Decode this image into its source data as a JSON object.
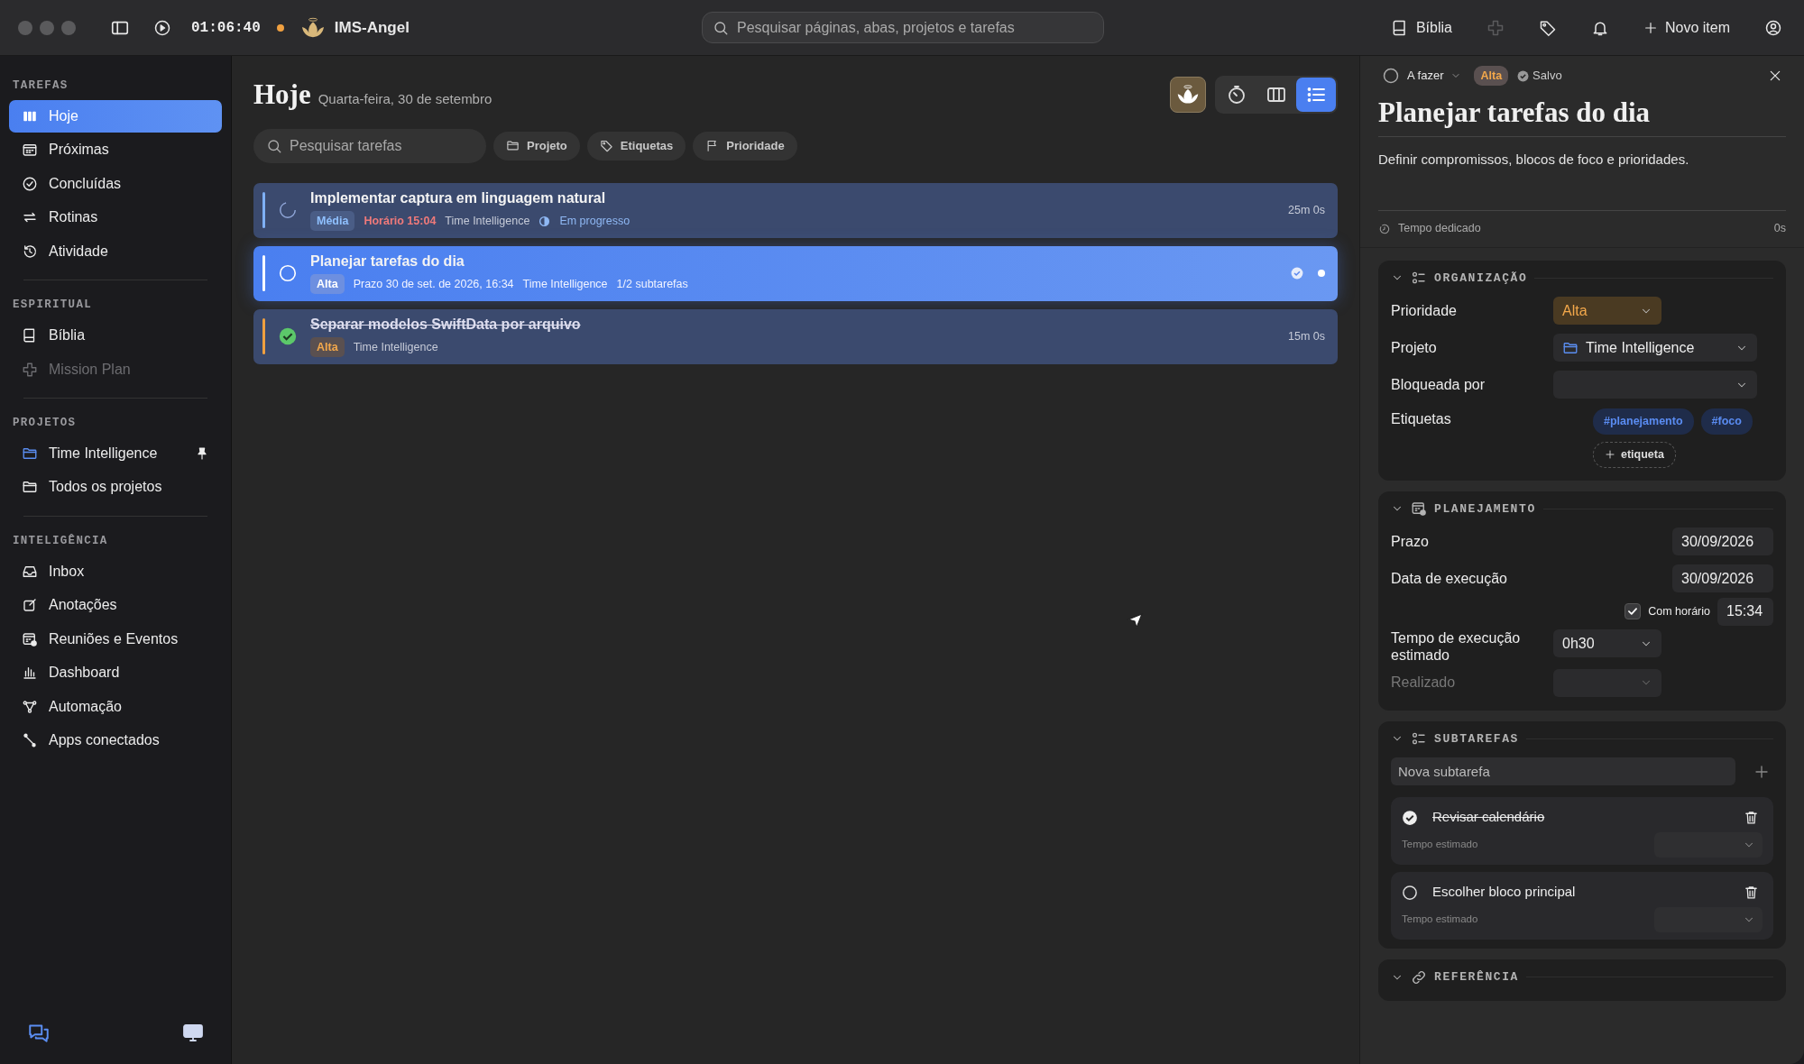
{
  "top_bar": {
    "timer": "01:06:40",
    "app_name": "IMS-Angel",
    "search_placeholder": "Pesquisar páginas, abas, projetos e tarefas",
    "actions": [
      {
        "kind": "book",
        "label": "Bíblia",
        "disabled": false
      },
      {
        "kind": "plus-cross",
        "disabled": true
      },
      {
        "kind": "tag",
        "disabled": false
      },
      {
        "kind": "bell",
        "disabled": false
      },
      {
        "kind": "plus",
        "label": "Novo item",
        "disabled": false
      },
      {
        "kind": "profile",
        "disabled": false
      }
    ]
  },
  "sidebar": {
    "sections": [
      {
        "title": "TAREFAS",
        "items": [
          {
            "label": "Hoje",
            "selected": true,
            "disabled": false,
            "pinned": false
          },
          {
            "label": "Próximas",
            "selected": false,
            "disabled": false,
            "pinned": false
          },
          {
            "label": "Concluídas",
            "selected": false,
            "disabled": false,
            "pinned": false
          },
          {
            "label": "Rotinas",
            "selected": false,
            "disabled": false,
            "pinned": false
          },
          {
            "label": "Atividade",
            "selected": false,
            "disabled": false,
            "pinned": false
          }
        ]
      },
      {
        "title": "ESPIRITUAL",
        "items": [
          {
            "label": "Bíblia",
            "selected": false,
            "disabled": false,
            "pinned": false
          },
          {
            "label": "Mission Plan",
            "selected": false,
            "disabled": true,
            "pinned": false
          }
        ]
      },
      {
        "title": "PROJETOS",
        "items": [
          {
            "label": "Time Intelligence",
            "selected": false,
            "disabled": false,
            "pinned": true
          },
          {
            "label": "Todos os projetos",
            "selected": false,
            "disabled": false,
            "pinned": false
          }
        ]
      },
      {
        "title": "INTELIGÊNCIA",
        "items": [
          {
            "label": "Inbox",
            "selected": false,
            "disabled": false,
            "pinned": false
          },
          {
            "label": "Anotações",
            "selected": false,
            "disabled": false,
            "pinned": false
          },
          {
            "label": "Reuniões e Eventos",
            "selected": false,
            "disabled": false,
            "pinned": false
          },
          {
            "label": "Dashboard",
            "selected": false,
            "disabled": false,
            "pinned": false
          },
          {
            "label": "Automação",
            "selected": false,
            "disabled": false,
            "pinned": false
          },
          {
            "label": "Apps conectados",
            "selected": false,
            "disabled": false,
            "pinned": false
          }
        ]
      }
    ]
  },
  "main": {
    "title": "Hoje",
    "date": "Quarta-feira, 30 de setembro",
    "views": [
      {
        "kind": "timer",
        "selected": false
      },
      {
        "kind": "columns",
        "selected": false
      },
      {
        "kind": "list",
        "selected": true
      }
    ],
    "search_placeholder": "Pesquisar tarefas",
    "filters": [
      {
        "label": "Projeto"
      },
      {
        "label": "Etiquetas"
      },
      {
        "label": "Prioridade"
      }
    ],
    "tasks": [
      {
        "title": "Implementar captura em linguagem natural",
        "kind": "in_progress",
        "selected": false,
        "priority": {
          "label": "Média",
          "kind": "media"
        },
        "meta": [
          {
            "text": "Horário 15:04",
            "kind": "alert"
          },
          {
            "text": "Time Intelligence",
            "kind": "plain"
          },
          {
            "text": "Em progresso",
            "kind": "progress"
          }
        ],
        "duration": "25m 0s"
      },
      {
        "title": "Planejar tarefas do dia",
        "kind": "todo",
        "selected": true,
        "priority": {
          "label": "Alta",
          "kind": "alta"
        },
        "meta": [
          {
            "text": "Prazo 30 de set. de 2026, 16:34",
            "kind": "plain"
          },
          {
            "text": "Time Intelligence",
            "kind": "plain"
          },
          {
            "text": "1/2 subtarefas",
            "kind": "plain"
          }
        ]
      },
      {
        "title": "Separar modelos SwiftData por arquivo",
        "kind": "done",
        "selected": false,
        "priority": {
          "label": "Alta",
          "kind": "alta"
        },
        "meta": [
          {
            "text": "Time Intelligence",
            "kind": "plain"
          }
        ],
        "duration": "15m 0s"
      }
    ]
  },
  "detail": {
    "status": "A fazer",
    "priority": {
      "label": "Alta",
      "kind": "alta"
    },
    "saved": "Salvo",
    "title": "Planejar tarefas do dia",
    "description": "Definir compromissos, blocos de foco e prioridades.",
    "time_label": "Tempo dedicado",
    "time_value": "0s",
    "sections": [
      {
        "title": "ORGANIZAÇÃO",
        "expanded": true,
        "rows": [
          {
            "kind": "priority",
            "label": "Prioridade",
            "value": "Alta",
            "disabled": false
          },
          {
            "kind": "project",
            "label": "Projeto",
            "value": "Time Intelligence",
            "disabled": false
          },
          {
            "kind": "select",
            "label": "Bloqueada por",
            "disabled": false
          },
          {
            "kind": "tags",
            "label": "Etiquetas",
            "tags": [
              "#planejamento",
              "#foco"
            ],
            "add_label": "etiqueta"
          }
        ]
      },
      {
        "title": "PLANEJAMENTO",
        "expanded": true,
        "rows": [
          {
            "kind": "date",
            "label": "Prazo",
            "value": "30/09/2026"
          },
          {
            "kind": "date",
            "label": "Data de execução",
            "value": "30/09/2026"
          },
          {
            "kind": "time",
            "label": "Com horário",
            "checked": true,
            "value": "15:34"
          },
          {
            "kind": "select",
            "label": "Tempo de execução estimado",
            "value": "0h30",
            "disabled": false
          },
          {
            "kind": "select",
            "label": "Realizado",
            "disabled": true
          }
        ]
      },
      {
        "title": "SUBTAREFAS",
        "expanded": true,
        "rows": [
          {
            "kind": "new_subtask",
            "placeholder": "Nova subtarefa"
          },
          {
            "kind": "subtask",
            "label": "Revisar calendário",
            "done": true,
            "estimate_label": "Tempo estimado"
          },
          {
            "kind": "subtask",
            "label": "Escolher bloco principal",
            "done": false,
            "estimate_label": "Tempo estimado"
          }
        ]
      },
      {
        "title": "REFERÊNCIA",
        "expanded": true
      }
    ]
  }
}
